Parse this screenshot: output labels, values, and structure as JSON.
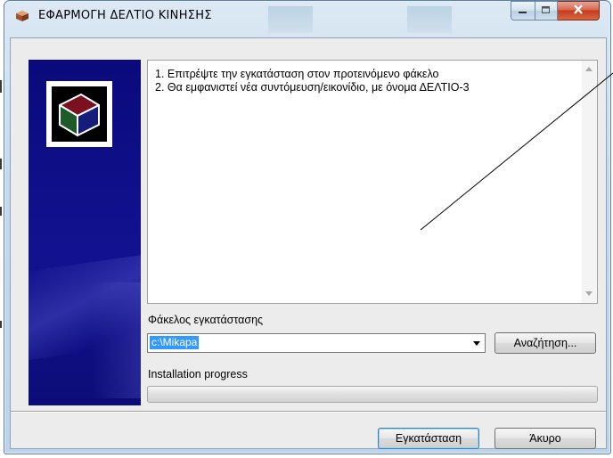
{
  "window": {
    "title": "ΕΦΑΡΜΟΓΗ ΔΕΛΤΙΟ ΚΙΝΗΣΗΣ",
    "icon": "installer-box-icon",
    "controls": [
      "minimize-icon",
      "maximize-icon",
      "close-icon"
    ]
  },
  "instructions": {
    "line1": "1. Επιτρέψτε την εγκατάσταση στον προτεινόμενο φάκελο",
    "line2": "2. Θα εμφανιστεί νέα συντόμευση/εικονίδιο,  με όνομα  ΔΕΛΤΙΟ-3"
  },
  "folder": {
    "label": "Φάκελος εγκατάστασης",
    "value": "c:\\Mikapa",
    "browse_label": "Αναζήτηση..."
  },
  "progress": {
    "label": "Installation progress",
    "value": 0
  },
  "footer": {
    "install_label": "Εγκατάσταση",
    "cancel_label": "Άκυρο"
  },
  "colors": {
    "side_panel": "#0a0a7c",
    "selection": "#3399ff",
    "close_button": "#c6391d"
  }
}
